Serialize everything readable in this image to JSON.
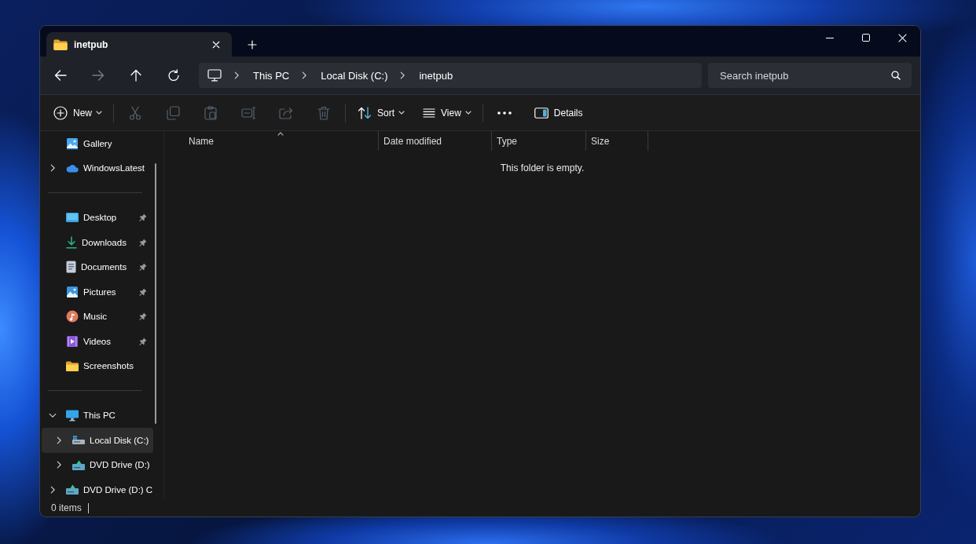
{
  "tabs": [
    {
      "label": "inetpub",
      "selected": true
    }
  ],
  "navigation": [
    {
      "kind": "back",
      "disabled": false
    },
    {
      "kind": "forward",
      "disabled": true
    },
    {
      "kind": "up",
      "disabled": false
    },
    {
      "kind": "refresh",
      "disabled": false
    }
  ],
  "address_bar": {
    "segments": [
      "This PC",
      "Local Disk (C:)",
      "inetpub"
    ]
  },
  "search": {
    "placeholder": "Search inetpub"
  },
  "toolbar": {
    "groups": [
      [
        {
          "kind": "new",
          "label": "New",
          "disabled": false
        }
      ],
      [
        {
          "kind": "cut",
          "disabled": true
        },
        {
          "kind": "copy",
          "disabled": true
        },
        {
          "kind": "paste",
          "disabled": true
        },
        {
          "kind": "rename",
          "disabled": true
        },
        {
          "kind": "share",
          "disabled": true
        },
        {
          "kind": "delete",
          "disabled": true
        }
      ],
      [
        {
          "kind": "sort",
          "label": "Sort",
          "disabled": false
        },
        {
          "kind": "view",
          "label": "View",
          "disabled": false
        }
      ],
      [
        {
          "kind": "more",
          "disabled": false
        }
      ]
    ],
    "details_button": {
      "label": "Details"
    }
  },
  "sidebar": {
    "sections": [
      {
        "items": [
          {
            "label": "Gallery",
            "kind": "gallery",
            "pinned": false,
            "selected": false
          },
          {
            "label": "WindowsLatest",
            "kind": "cloud",
            "expanded": false,
            "pinned": false,
            "selected": false
          }
        ]
      },
      {
        "items": [
          {
            "label": "Desktop",
            "kind": "desktop",
            "pinned": true,
            "selected": false
          },
          {
            "label": "Downloads",
            "kind": "downloads",
            "pinned": true,
            "selected": false
          },
          {
            "label": "Documents",
            "kind": "documents",
            "pinned": true,
            "selected": false
          },
          {
            "label": "Pictures",
            "kind": "pictures",
            "pinned": true,
            "selected": false
          },
          {
            "label": "Music",
            "kind": "music",
            "pinned": true,
            "selected": false
          },
          {
            "label": "Videos",
            "kind": "videos",
            "pinned": true,
            "selected": false
          },
          {
            "label": "Screenshots",
            "kind": "folder",
            "pinned": false,
            "selected": false
          }
        ]
      },
      {
        "items": [
          {
            "label": "This PC",
            "kind": "pc",
            "expanded": true,
            "pinned": false,
            "selected": false,
            "children": [
              {
                "label": "Local Disk (C:)",
                "kind": "drive",
                "expanded": false,
                "pinned": false,
                "selected": true
              },
              {
                "label": "DVD Drive (D:)",
                "kind": "dvd",
                "expanded": false,
                "pinned": false,
                "selected": false
              }
            ]
          },
          {
            "label": "DVD Drive (D:) C",
            "kind": "dvd",
            "expanded": false,
            "pinned": false,
            "selected": false
          }
        ]
      }
    ]
  },
  "columns": [
    {
      "label": "Name",
      "sorted": true
    },
    {
      "label": "Date modified",
      "sorted": false
    },
    {
      "label": "Type",
      "sorted": false
    },
    {
      "label": "Size",
      "sorted": false
    }
  ],
  "empty_message": "This folder is empty.",
  "status_bar": {
    "item_count": "0 items"
  }
}
